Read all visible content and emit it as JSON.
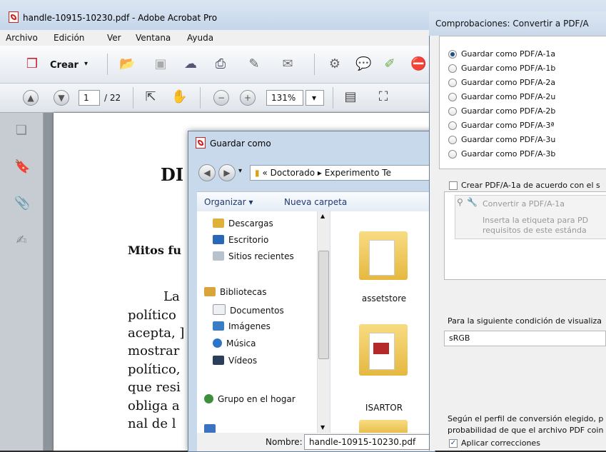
{
  "acrobat": {
    "title": "handle-10915-10230.pdf - Adobe Acrobat Pro",
    "menu": [
      "Archivo",
      "Edición",
      "Ver",
      "Ventana",
      "Ayuda"
    ],
    "create_label": "Crear",
    "page_current": "1",
    "page_total": "/ 22",
    "zoom": "131%"
  },
  "document": {
    "heading": "DI",
    "subheading": "Mitos fu",
    "lines": [
      "La",
      "político",
      "acepta, ]",
      "mostrar",
      "político,",
      "que resi",
      "obliga a",
      "nal de l"
    ]
  },
  "save_dialog": {
    "title": "Guardar como",
    "breadcrumb_prefix": "«",
    "breadcrumb_1": "Doctorado",
    "breadcrumb_2": "Experimento Te",
    "organize_label": "Organizar",
    "new_folder_label": "Nueva carpeta",
    "nav_items": [
      "Descargas",
      "Escritorio",
      "Sitios recientes",
      "Bibliotecas",
      "Documentos",
      "Imágenes",
      "Música",
      "Vídeos",
      "Grupo en el hogar"
    ],
    "folders": [
      "assetstore",
      "ISARTOR"
    ],
    "filename_label": "Nombre:",
    "filename_value": "handle-10915-10230.pdf"
  },
  "pdfa_dialog": {
    "title": "Comprobaciones: Convertir a PDF/A",
    "options": [
      "Guardar como PDF/A-1a",
      "Guardar como PDF/A-1b",
      "Guardar como PDF/A-2a",
      "Guardar como PDF/A-2u",
      "Guardar como PDF/A-2b",
      "Guardar como PDF/A-3ª",
      "Guardar como PDF/A-3u",
      "Guardar como PDF/A-3b"
    ],
    "selected_index": 0,
    "create_checkbox_label": "Crear PDF/A-1a de acuerdo con el s",
    "tree_item": "Convertir a PDF/A-1a",
    "tree_desc_1": "Inserta la etiqueta para PD",
    "tree_desc_2": "requisitos de este estánda",
    "condition_label": "Para la siguiente condición de visualiza",
    "condition_value": "sRGB",
    "note_1": "Según el perfil de conversión elegido, p",
    "note_2": "probabilidad de que el archivo PDF coin",
    "apply_label": "Aplicar correcciones"
  }
}
